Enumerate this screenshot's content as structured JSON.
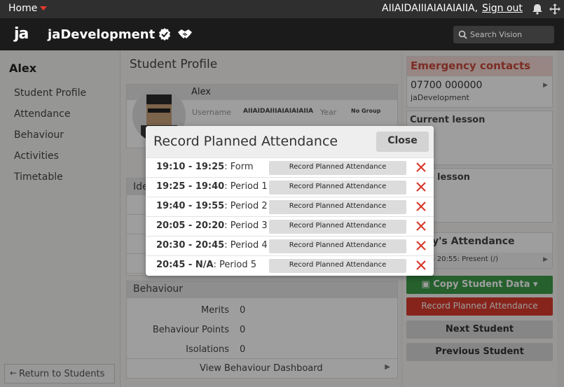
{
  "topbar": {
    "home_label": "Home",
    "user_name": "AIIAIDAIIIAIAIAIAIIA,",
    "signout_label": "Sign out"
  },
  "header": {
    "logo_text": "ja",
    "app_name": "jaDevelopment",
    "search_placeholder": "Search Vision"
  },
  "sidebar": {
    "student_name": "Alex",
    "items": [
      {
        "label": "Student Profile"
      },
      {
        "label": "Attendance"
      },
      {
        "label": "Behaviour"
      },
      {
        "label": "Activities"
      },
      {
        "label": "Timetable"
      }
    ],
    "return_label": "Return to Students"
  },
  "main": {
    "title": "Student Profile",
    "profile": {
      "name": "Alex",
      "username_label": "Username",
      "username_value": "AIIAIDAIIIAIAIAIAIIA",
      "year_label": "Year",
      "group_value": "No Group"
    },
    "identity_header": "Ide",
    "behaviour": {
      "header": "Behaviour",
      "rows": [
        {
          "label": "Merits",
          "value": "0"
        },
        {
          "label": "Behaviour Points",
          "value": "0"
        },
        {
          "label": "Isolations",
          "value": "0"
        }
      ],
      "dashboard_label": "View Behaviour Dashboard"
    }
  },
  "right": {
    "emergency_title": "Emergency contacts",
    "emergency_phone": "07700 000000",
    "emergency_org": "jaDevelopment",
    "current_lesson": "Current lesson",
    "next_lesson_partial": "lesson",
    "today_title_partial": "y's Attendance",
    "today_line": "- 20:55: Present (/)",
    "copy_label": "Copy Student Data",
    "record_label": "Record Planned Attendance",
    "next_label": "Next Student",
    "prev_label": "Previous Student"
  },
  "modal": {
    "title": "Record Planned Attendance",
    "close_label": "Close",
    "rows": [
      {
        "time": "19:10 - 19:25",
        "period": ": Form",
        "button": "Record Planned Attendance"
      },
      {
        "time": "19:25 - 19:40",
        "period": ": Period 1",
        "button": "Record Planned Attendance"
      },
      {
        "time": "19:40 - 19:55",
        "period": ": Period 2",
        "button": "Record Planned Attendance"
      },
      {
        "time": "20:05 - 20:20",
        "period": ": Period 3",
        "button": "Record Planned Attendance"
      },
      {
        "time": "20:30 - 20:45",
        "period": ": Period 4",
        "button": "Record Planned Attendance"
      },
      {
        "time": "20:45 - N/A",
        "period": ": Period 5",
        "button": "Record Planned Attendance"
      }
    ]
  },
  "colors": {
    "accent_red": "#e53a2a",
    "record_red": "#d83b2c",
    "copy_green": "#3d9c4a",
    "emergency_bg": "#f4d8d3"
  },
  "icons": [
    "caret-down-icon",
    "bell-icon",
    "move-icon",
    "verified-badge-icon",
    "handshake-icon",
    "search-icon",
    "close-x-icon",
    "chevron-right-icon",
    "arrow-left-icon",
    "copy-icon"
  ]
}
